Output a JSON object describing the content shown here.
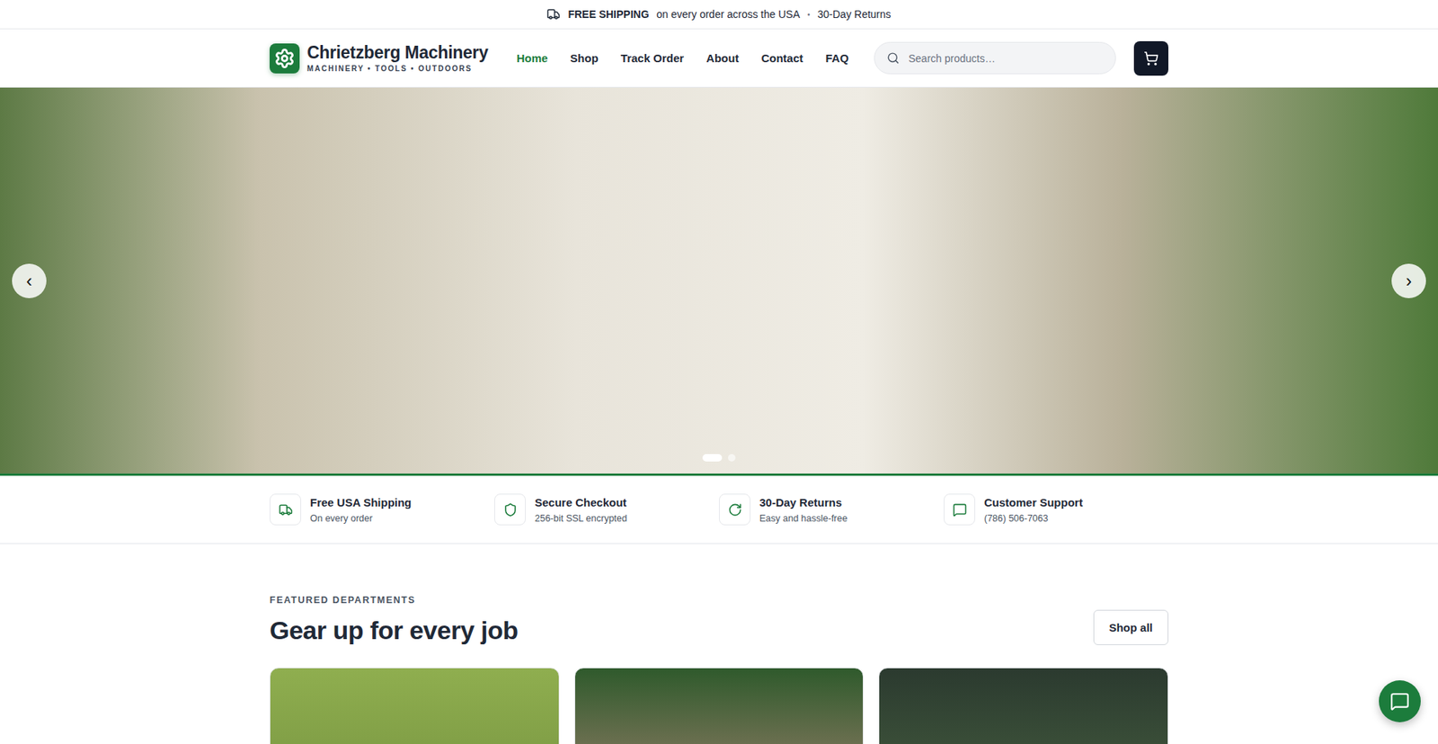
{
  "announcement": {
    "highlight": "FREE SHIPPING",
    "text": "on every order across the USA",
    "separator": "•",
    "extra": "30-Day Returns"
  },
  "brand": {
    "name": "Chrietzberg Machinery",
    "tagline": "MACHINERY • TOOLS • OUTDOORS"
  },
  "nav": [
    {
      "label": "Home",
      "selected": true
    },
    {
      "label": "Shop",
      "selected": false
    },
    {
      "label": "Track Order",
      "selected": false
    },
    {
      "label": "About",
      "selected": false
    },
    {
      "label": "Contact",
      "selected": false
    },
    {
      "label": "FAQ",
      "selected": false
    }
  ],
  "search": {
    "placeholder": "Search products…"
  },
  "hero": {
    "prev": "‹",
    "next": "›",
    "slides": [
      {
        "selected": true
      },
      {
        "selected": false
      }
    ]
  },
  "features": [
    {
      "title": "Free USA Shipping",
      "subtitle": "On every order"
    },
    {
      "title": "Secure Checkout",
      "subtitle": "256-bit SSL encrypted"
    },
    {
      "title": "30-Day Returns",
      "subtitle": "Easy and hassle-free"
    },
    {
      "title": "Customer Support",
      "subtitle": "(786) 506-7063"
    }
  ],
  "section": {
    "eyebrow": "FEATURED DEPARTMENTS",
    "title": "Gear up for every job",
    "button": "Shop all"
  },
  "departments": [
    {},
    {},
    {}
  ]
}
